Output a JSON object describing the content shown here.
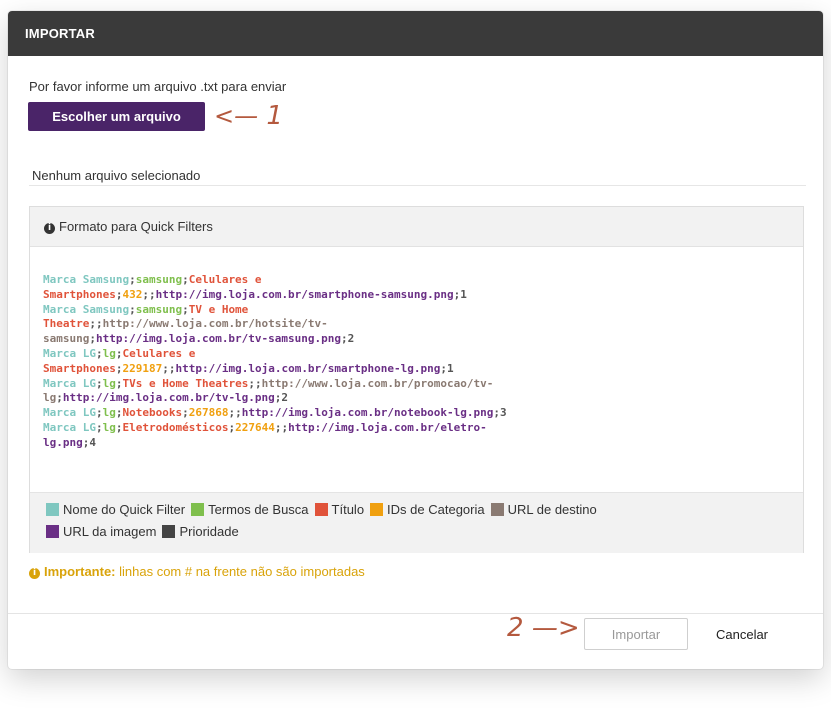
{
  "modal": {
    "title": "IMPORTAR",
    "intro": "Por favor informe um arquivo .txt para enviar",
    "choose_button": "Escolher um arquivo",
    "file_status": "Nenhum arquivo selecionado"
  },
  "annotations": {
    "step1_arrow": "<—",
    "step1": "1",
    "step2": "2",
    "step2_arrow": "—>"
  },
  "panel": {
    "title": "Formato para Quick Filters",
    "lines": [
      [
        {
          "t": "Marca Samsung",
          "c": "name"
        },
        {
          "t": ";",
          "c": "sep"
        },
        {
          "t": "samsung",
          "c": "terms"
        },
        {
          "t": ";",
          "c": "sep"
        },
        {
          "t": "Celulares e",
          "c": "title"
        }
      ],
      [
        {
          "t": "Smartphones",
          "c": "title"
        },
        {
          "t": ";",
          "c": "sep"
        },
        {
          "t": "432",
          "c": "catid"
        },
        {
          "t": ";;",
          "c": "sep"
        },
        {
          "t": "http://img.loja.com.br/smartphone-samsung.png",
          "c": "img"
        },
        {
          "t": ";1",
          "c": "sep"
        }
      ],
      [
        {
          "t": "Marca Samsung",
          "c": "name"
        },
        {
          "t": ";",
          "c": "sep"
        },
        {
          "t": "samsung",
          "c": "terms"
        },
        {
          "t": ";",
          "c": "sep"
        },
        {
          "t": "TV e Home",
          "c": "title"
        }
      ],
      [
        {
          "t": "Theatre",
          "c": "title"
        },
        {
          "t": ";;",
          "c": "sep"
        },
        {
          "t": "http://www.loja.com.br/hotsite/tv-",
          "c": "dest"
        }
      ],
      [
        {
          "t": "samsung",
          "c": "dest"
        },
        {
          "t": ";",
          "c": "sep"
        },
        {
          "t": "http://img.loja.com.br/tv-samsung.png",
          "c": "img"
        },
        {
          "t": ";2",
          "c": "sep"
        }
      ],
      [
        {
          "t": "Marca LG",
          "c": "name"
        },
        {
          "t": ";",
          "c": "sep"
        },
        {
          "t": "lg",
          "c": "terms"
        },
        {
          "t": ";",
          "c": "sep"
        },
        {
          "t": "Celulares e",
          "c": "title"
        }
      ],
      [
        {
          "t": "Smartphones",
          "c": "title"
        },
        {
          "t": ";",
          "c": "sep"
        },
        {
          "t": "229187",
          "c": "catid"
        },
        {
          "t": ";;",
          "c": "sep"
        },
        {
          "t": "http://img.loja.com.br/smartphone-lg.png",
          "c": "img"
        },
        {
          "t": ";1",
          "c": "sep"
        }
      ],
      [
        {
          "t": "Marca LG",
          "c": "name"
        },
        {
          "t": ";",
          "c": "sep"
        },
        {
          "t": "lg",
          "c": "terms"
        },
        {
          "t": ";",
          "c": "sep"
        },
        {
          "t": "TVs e Home Theatres",
          "c": "title"
        },
        {
          "t": ";;",
          "c": "sep"
        },
        {
          "t": "http://www.loja.com.br/promocao/tv-",
          "c": "dest"
        }
      ],
      [
        {
          "t": "lg",
          "c": "dest"
        },
        {
          "t": ";",
          "c": "sep"
        },
        {
          "t": "http://img.loja.com.br/tv-lg.png",
          "c": "img"
        },
        {
          "t": ";2",
          "c": "sep"
        }
      ],
      [
        {
          "t": "Marca LG",
          "c": "name"
        },
        {
          "t": ";",
          "c": "sep"
        },
        {
          "t": "lg",
          "c": "terms"
        },
        {
          "t": ";",
          "c": "sep"
        },
        {
          "t": "Notebooks",
          "c": "title"
        },
        {
          "t": ";",
          "c": "sep"
        },
        {
          "t": "267868",
          "c": "catid"
        },
        {
          "t": ";;",
          "c": "sep"
        },
        {
          "t": "http://img.loja.com.br/notebook-lg.png",
          "c": "img"
        },
        {
          "t": ";3",
          "c": "sep"
        }
      ],
      [
        {
          "t": "Marca LG",
          "c": "name"
        },
        {
          "t": ";",
          "c": "sep"
        },
        {
          "t": "lg",
          "c": "terms"
        },
        {
          "t": ";",
          "c": "sep"
        },
        {
          "t": "Eletrodomésticos",
          "c": "title"
        },
        {
          "t": ";",
          "c": "sep"
        },
        {
          "t": "227644",
          "c": "catid"
        },
        {
          "t": ";;",
          "c": "sep"
        },
        {
          "t": "http://img.loja.com.br/eletro-",
          "c": "img"
        }
      ],
      [
        {
          "t": "lg.png",
          "c": "img"
        },
        {
          "t": ";4",
          "c": "sep"
        }
      ]
    ],
    "legend_row1": [
      {
        "label": "Nome do Quick Filter",
        "color": "#7fc7c0"
      },
      {
        "label": "Termos de Busca",
        "color": "#7fbf4d"
      },
      {
        "label": "Título",
        "color": "#e0533a"
      },
      {
        "label": "IDs de Categoria",
        "color": "#f0a010"
      },
      {
        "label": "URL  de destino",
        "color": "#8a7a72"
      }
    ],
    "legend_row2": [
      {
        "label": "URL da imagem",
        "color": "#6a2f85"
      },
      {
        "label": "Prioridade",
        "color": "#444444"
      }
    ]
  },
  "important": {
    "label": "Importante:",
    "text": " linhas com # na frente não são importadas"
  },
  "footer": {
    "import_button": "Importar",
    "cancel_button": "Cancelar"
  },
  "colors": {
    "header_bg": "#3a3a3a",
    "primary_button": "#4a2468",
    "warning": "#d9a30a",
    "annotation": "#b4593e"
  }
}
